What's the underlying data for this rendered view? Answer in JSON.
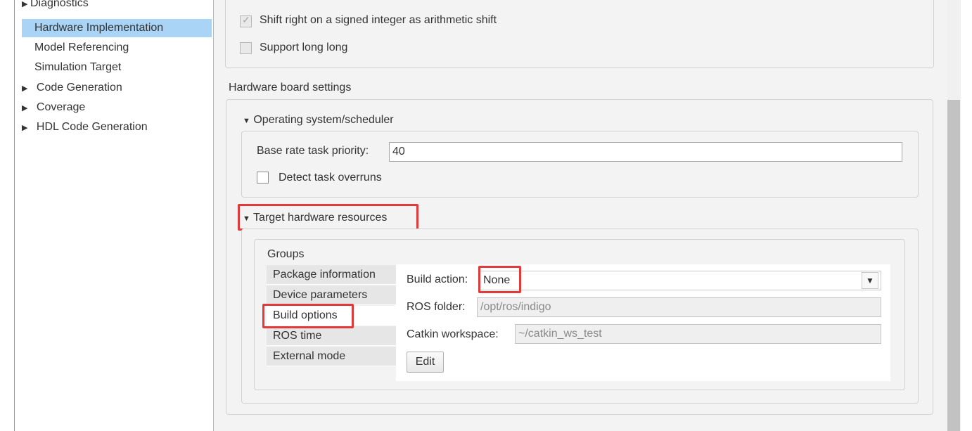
{
  "tree": {
    "items": [
      {
        "label": "Diagnostics",
        "arrow": "▶"
      },
      {
        "label": "Hardware Implementation",
        "arrow": ""
      },
      {
        "label": "Model Referencing",
        "arrow": ""
      },
      {
        "label": "Simulation Target",
        "arrow": ""
      },
      {
        "label": "Code Generation",
        "arrow": "▶"
      },
      {
        "label": "Coverage",
        "arrow": "▶"
      },
      {
        "label": "HDL Code Generation",
        "arrow": "▶"
      }
    ],
    "selected": "Hardware Implementation"
  },
  "device_details": {
    "shift_right_label": "Shift right on a signed integer as arithmetic shift",
    "shift_right_checked": true,
    "support_long_long_label": "Support long long",
    "support_long_long_checked": false
  },
  "hardware_board": {
    "section_title": "Hardware board settings",
    "os_scheduler": {
      "title": "Operating system/scheduler",
      "expand_glyph": "▼",
      "priority_label": "Base rate task priority:",
      "priority_value": "40",
      "detect_overruns_label": "Detect task overruns",
      "detect_overruns_checked": false
    },
    "target_resources": {
      "title": "Target hardware resources",
      "expand_glyph": "▼",
      "groups_label": "Groups",
      "groups": [
        "Package information",
        "Device parameters",
        "Build options",
        "ROS time",
        "External mode"
      ],
      "active_group": "Build options",
      "build_action_label": "Build action:",
      "build_action_value": "None",
      "dropdown_glyph": "▼",
      "ros_folder_label": "ROS folder:",
      "ros_folder_value": "/opt/ros/indigo",
      "catkin_label": "Catkin workspace:",
      "catkin_value": "~/catkin_ws_test",
      "edit_button": "Edit"
    }
  },
  "colors": {
    "selection": "#a9d4f5",
    "annotation": "#e03a3a",
    "panel_background": "#f3f3f3"
  }
}
